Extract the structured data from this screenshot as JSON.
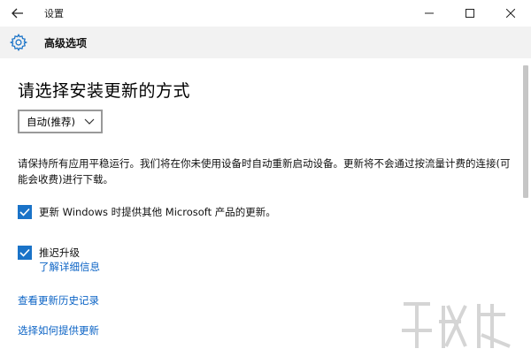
{
  "window": {
    "title": "设置",
    "minimize_glyph": "—",
    "maximize_glyph": "☐",
    "close_glyph": "✕"
  },
  "header": {
    "title": "高级选项"
  },
  "main": {
    "heading": "请选择安装更新的方式",
    "install_mode": {
      "selected": "自动(推荐)"
    },
    "description": "请保持所有应用平稳运行。我们将在你未使用设备时自动重新启动设备。更新将不会通过按流量计费的连接(可能会收费)进行下载。",
    "options": [
      {
        "label": "更新 Windows 时提供其他 Microsoft 产品的更新。",
        "checked": true
      },
      {
        "label": "推迟升级",
        "checked": true
      }
    ],
    "defer_learn_more": "了解详细信息",
    "links": [
      "查看更新历史记录",
      "选择如何提供更新"
    ]
  },
  "colors": {
    "accent": "#1a73c8",
    "link": "#0b63c5",
    "header_bg": "#f2f2f2"
  }
}
